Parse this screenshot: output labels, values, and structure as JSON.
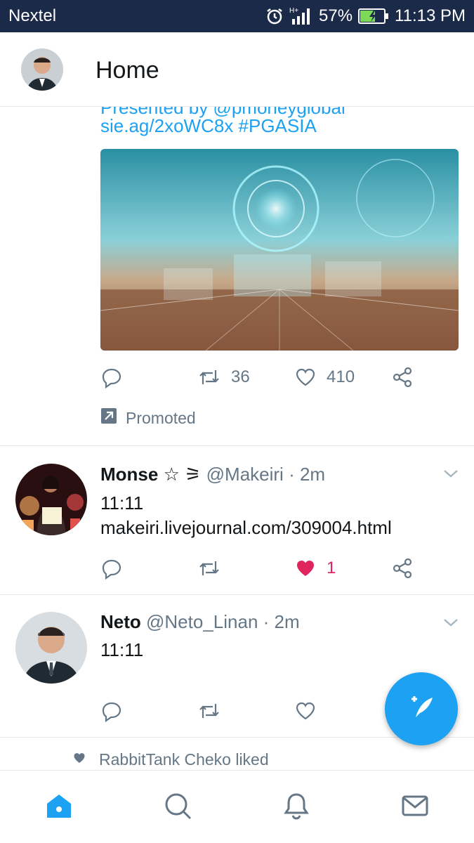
{
  "status_bar": {
    "carrier": "Nextel",
    "network": "H+",
    "battery_percent": "57%",
    "time": "11:13 PM",
    "icons": [
      "alarm-icon",
      "signal-icon",
      "battery-charging-icon"
    ]
  },
  "app_bar": {
    "title": "Home",
    "avatar": "profile-avatar"
  },
  "tweets": [
    {
      "type": "promoted",
      "partial_text": "Presented by @pmoneyglobal",
      "link_text": "sie.ag/2xoWC8x #PGASIA",
      "media": "futuristic-city-image",
      "actions": {
        "reply": "",
        "retweet": "36",
        "like": "410"
      },
      "promoted_label": "Promoted"
    },
    {
      "name": "Monse ☆ ⚞",
      "handle": "@Makeiri",
      "time": "· 2m",
      "text": "11:11",
      "link": "makeiri.livejournal.com/309004.html",
      "actions": {
        "retweet": "",
        "like": "1",
        "liked": true
      }
    },
    {
      "name": "Neto",
      "handle": "@Neto_Linan",
      "time": "· 2m",
      "text": "11:11",
      "actions": {
        "retweet": "",
        "like": ""
      }
    }
  ],
  "liked_notice": {
    "text": "RabbitTank Cheko liked"
  },
  "fab": {
    "icon": "compose-tweet-icon"
  },
  "colors": {
    "accent": "#1da1f2",
    "status_bar": "#1c2a4a",
    "like_active": "#e0245e",
    "muted": "#657786"
  },
  "bottom_nav": [
    "home-icon",
    "search-icon",
    "notifications-icon",
    "messages-icon"
  ]
}
